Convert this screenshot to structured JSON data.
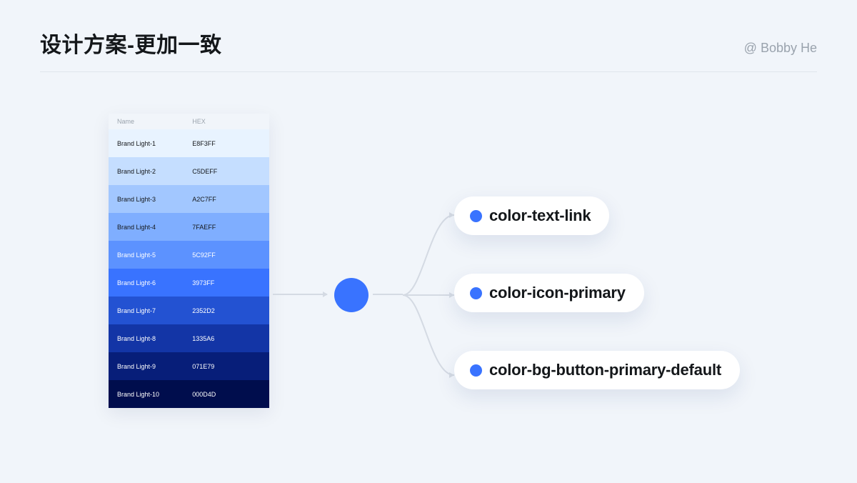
{
  "header": {
    "title": "设计方案-更加一致",
    "author": "@ Bobby He"
  },
  "palette": {
    "columns": {
      "name": "Name",
      "hex": "HEX"
    },
    "rows": [
      {
        "name": "Brand Light-1",
        "hex": "E8F3FF",
        "bg": "#E8F3FF",
        "fg": "light"
      },
      {
        "name": "Brand Light-2",
        "hex": "C5DEFF",
        "bg": "#C5DEFF",
        "fg": "light"
      },
      {
        "name": "Brand Light-3",
        "hex": "A2C7FF",
        "bg": "#A2C7FF",
        "fg": "light"
      },
      {
        "name": "Brand Light-4",
        "hex": "7FAEFF",
        "bg": "#7FAEFF",
        "fg": "light"
      },
      {
        "name": "Brand Light-5",
        "hex": "5C92FF",
        "bg": "#5C92FF",
        "fg": "dark"
      },
      {
        "name": "Brand Light-6",
        "hex": "3973FF",
        "bg": "#3973FF",
        "fg": "dark"
      },
      {
        "name": "Brand Light-7",
        "hex": "2352D2",
        "bg": "#2352D2",
        "fg": "dark"
      },
      {
        "name": "Brand Light-8",
        "hex": "1335A6",
        "bg": "#1335A6",
        "fg": "dark"
      },
      {
        "name": "Brand Light-9",
        "hex": "071E79",
        "bg": "#071E79",
        "fg": "dark"
      },
      {
        "name": "Brand Light-10",
        "hex": "000D4D",
        "bg": "#000D4D",
        "fg": "dark"
      }
    ]
  },
  "brand_color": "#3973FF",
  "tokens": [
    {
      "label": "color-text-link"
    },
    {
      "label": "color-icon-primary"
    },
    {
      "label": "color-bg-button-primary-default"
    }
  ]
}
